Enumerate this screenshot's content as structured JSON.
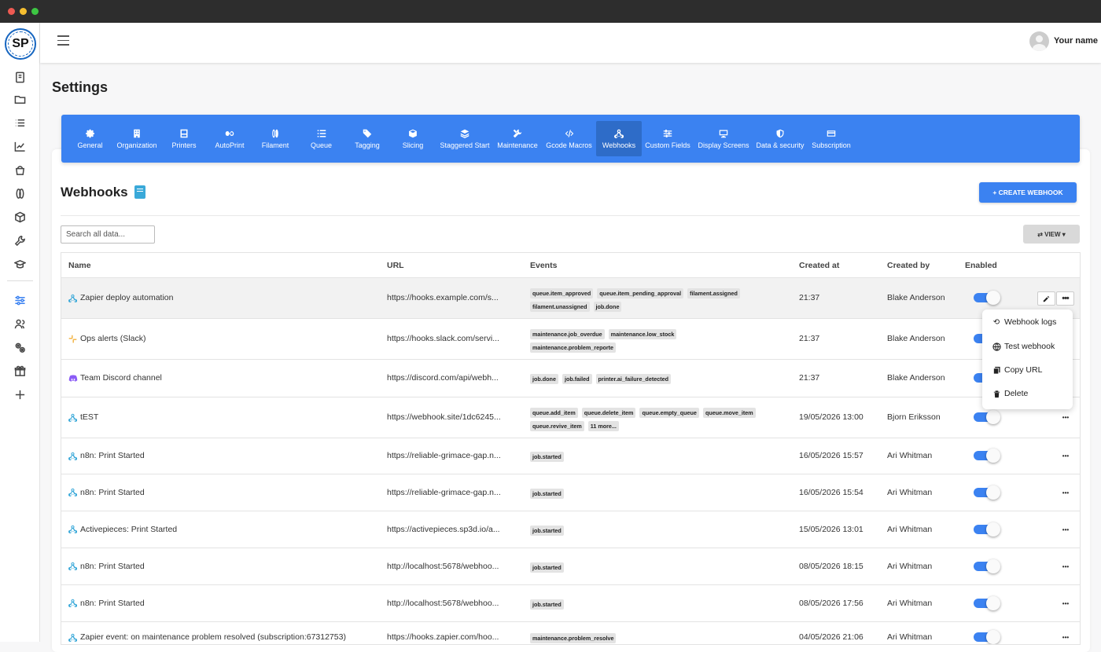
{
  "header": {
    "user_name": "Your name",
    "logo_text": "SP"
  },
  "page": {
    "title": "Settings"
  },
  "tabs": [
    {
      "label": "General",
      "icon": "gear-icon"
    },
    {
      "label": "Organization",
      "icon": "building-icon"
    },
    {
      "label": "Printers",
      "icon": "printer-icon"
    },
    {
      "label": "AutoPrint",
      "icon": "infinity-icon"
    },
    {
      "label": "Filament",
      "icon": "filament-icon"
    },
    {
      "label": "Queue",
      "icon": "list-icon"
    },
    {
      "label": "Tagging",
      "icon": "tags-icon"
    },
    {
      "label": "Slicing",
      "icon": "cube-icon"
    },
    {
      "label": "Staggered Start",
      "icon": "layers-icon"
    },
    {
      "label": "Maintenance",
      "icon": "tools-icon"
    },
    {
      "label": "Gcode Macros",
      "icon": "code-icon"
    },
    {
      "label": "Webhooks",
      "icon": "webhook-icon",
      "active": true
    },
    {
      "label": "Custom Fields",
      "icon": "sliders-icon"
    },
    {
      "label": "Display Screens",
      "icon": "monitor-icon"
    },
    {
      "label": "Data & security",
      "icon": "shield-icon"
    },
    {
      "label": "Subscription",
      "icon": "credit-card-icon"
    }
  ],
  "webhooks": {
    "title": "Webhooks",
    "create_label": "+ CREATE WEBHOOK",
    "search_placeholder": "Search all data...",
    "view_label": "⇄ VIEW ▾",
    "columns": [
      "Name",
      "URL",
      "Events",
      "Created at",
      "Created by",
      "Enabled"
    ],
    "rows": [
      {
        "name": "Zapier deploy automation",
        "icon": "webhook-icon",
        "url": "https://hooks.example.com/s...",
        "events": [
          "queue.item_approved",
          "queue.item_pending_approval",
          "filament.assigned",
          "filament.unassigned",
          "job.done"
        ],
        "created_at": "21:37",
        "created_by": "Blake Anderson",
        "enabled": true
      },
      {
        "name": "Ops alerts (Slack)",
        "icon": "slack-icon",
        "url": "https://hooks.slack.com/servi...",
        "events": [
          "maintenance.job_overdue",
          "maintenance.low_stock",
          "maintenance.problem_reporte"
        ],
        "created_at": "21:37",
        "created_by": "Blake Anderson",
        "enabled": true
      },
      {
        "name": "Team Discord channel",
        "icon": "discord-icon",
        "url": "https://discord.com/api/webh...",
        "events": [
          "job.done",
          "job.failed",
          "printer.ai_failure_detected"
        ],
        "created_at": "21:37",
        "created_by": "Blake Anderson",
        "enabled": true
      },
      {
        "name": "tEST",
        "icon": "webhook-icon",
        "url": "https://webhook.site/1dc6245...",
        "events": [
          "queue.add_item",
          "queue.delete_item",
          "queue.empty_queue",
          "queue.move_item",
          "queue.revive_item",
          "11 more..."
        ],
        "created_at": "19/05/2026 13:00",
        "created_by": "Bjorn Eriksson",
        "enabled": true
      },
      {
        "name": "n8n: Print Started",
        "icon": "webhook-icon",
        "url": "https://reliable-grimace-gap.n...",
        "events": [
          "job.started"
        ],
        "created_at": "16/05/2026 15:57",
        "created_by": "Ari Whitman",
        "enabled": true
      },
      {
        "name": "n8n: Print Started",
        "icon": "webhook-icon",
        "url": "https://reliable-grimace-gap.n...",
        "events": [
          "job.started"
        ],
        "created_at": "16/05/2026 15:54",
        "created_by": "Ari Whitman",
        "enabled": true
      },
      {
        "name": "Activepieces: Print Started",
        "icon": "webhook-icon",
        "url": "https://activepieces.sp3d.io/a...",
        "events": [
          "job.started"
        ],
        "created_at": "15/05/2026 13:01",
        "created_by": "Ari Whitman",
        "enabled": true
      },
      {
        "name": "n8n: Print Started",
        "icon": "webhook-icon",
        "url": "http://localhost:5678/webhoo...",
        "events": [
          "job.started"
        ],
        "created_at": "08/05/2026 18:15",
        "created_by": "Ari Whitman",
        "enabled": true
      },
      {
        "name": "n8n: Print Started",
        "icon": "webhook-icon",
        "url": "http://localhost:5678/webhoo...",
        "events": [
          "job.started"
        ],
        "created_at": "08/05/2026 17:56",
        "created_by": "Ari Whitman",
        "enabled": true
      },
      {
        "name": "Zapier event: on maintenance problem resolved (subscription:67312753)",
        "icon": "webhook-icon",
        "url": "https://hooks.zapier.com/hoo...",
        "events": [
          "maintenance.problem_resolve"
        ],
        "created_at": "04/05/2026 21:06",
        "created_by": "Ari Whitman",
        "enabled": true
      }
    ]
  },
  "row_menu": {
    "items": [
      {
        "label": "Webhook logs",
        "icon": "history-icon"
      },
      {
        "label": "Test webhook",
        "icon": "globe-icon"
      },
      {
        "label": "Copy URL",
        "icon": "copy-icon"
      },
      {
        "label": "Delete",
        "icon": "trash-icon"
      }
    ]
  },
  "colors": {
    "accent": "#3b82f1",
    "accent_active": "#2e6cc8"
  }
}
